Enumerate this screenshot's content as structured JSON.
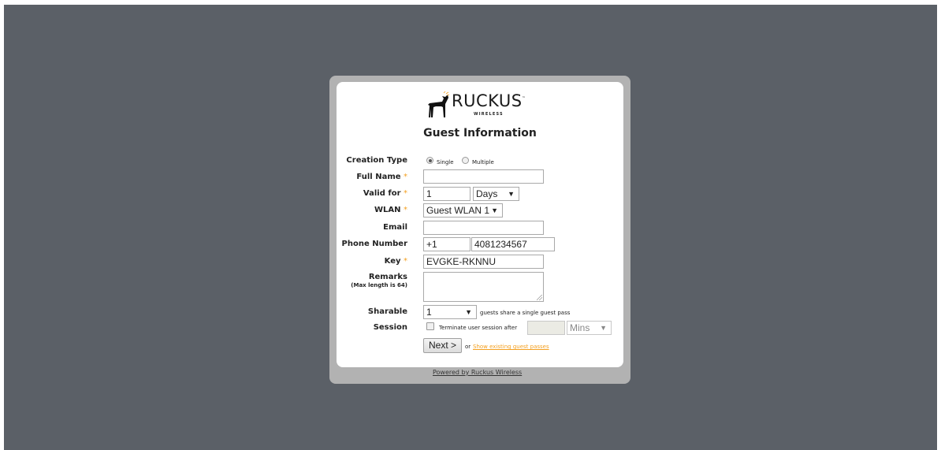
{
  "brand": {
    "name": "RUCKUS",
    "subtitle": "WIRELESS",
    "trademark": "™"
  },
  "form": {
    "title": "Guest Information",
    "creation_type": {
      "label": "Creation Type",
      "options": [
        "Single",
        "Multiple"
      ],
      "selected": "Single"
    },
    "full_name": {
      "label": "Full Name",
      "required_mark": "*",
      "value": ""
    },
    "valid_for": {
      "label": "Valid for",
      "required_mark": "*",
      "value": "1",
      "unit": "Days"
    },
    "wlan": {
      "label": "WLAN",
      "required_mark": "*",
      "value": "Guest WLAN 1"
    },
    "email": {
      "label": "Email",
      "value": ""
    },
    "phone": {
      "label": "Phone Number",
      "country_code": "+1",
      "number": "4081234567"
    },
    "key": {
      "label": "Key",
      "required_mark": "*",
      "value": "EVGKE-RKNNU"
    },
    "remarks": {
      "label": "Remarks",
      "sublabel": "(Max length is 64)",
      "value": ""
    },
    "sharable": {
      "label": "Sharable",
      "value": "1",
      "suffix": "guests share a single guest pass"
    },
    "session": {
      "label": "Session",
      "checkbox_label": "Terminate user session after",
      "checked": false,
      "value": "",
      "unit": "Mins"
    },
    "next_button": "Next >",
    "or_text": "or",
    "show_existing_link": "Show existing guest passes"
  },
  "footer": {
    "powered_by": "Powered by Ruckus Wireless"
  },
  "colors": {
    "background": "#5b6067",
    "frame": "#b2b2b2",
    "required": "#f4a020",
    "link": "#f4a020"
  }
}
